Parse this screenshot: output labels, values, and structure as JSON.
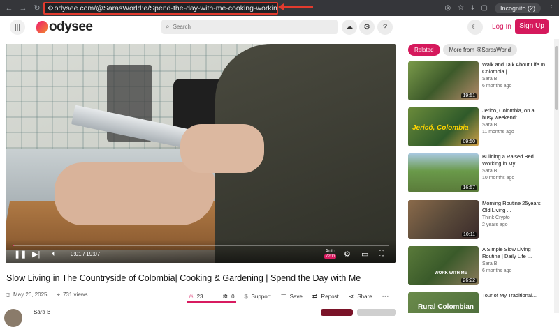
{
  "browser": {
    "url": "odysee.com/@SarasWorld:e/Spend-the-day-with-me-cooking-working-in-the-garden:f",
    "incognito_label": "Incognito (2)"
  },
  "header": {
    "logo_text": "odysee",
    "search_placeholder": "Search",
    "login_label": "Log In",
    "signup_label": "Sign Up"
  },
  "player": {
    "current_time": "0:01",
    "duration": "19:07",
    "separator": "/",
    "quality_mode": "Auto",
    "quality": "720p",
    "progress_fraction": 0.001
  },
  "video": {
    "title": "Slow Living in The Countryside of Colombia| Cooking & Gardening | Spend the Day with Me",
    "date": "May 26, 2025",
    "views": "731 views",
    "fire_count": "23",
    "slime_count": "0",
    "support_label": "Support",
    "save_label": "Save",
    "repost_label": "Repost",
    "share_label": "Share",
    "channel_name": "Sara B"
  },
  "sidebar": {
    "tabs": [
      {
        "label": "Related"
      },
      {
        "label": "More from @SarasWorld"
      }
    ],
    "items": [
      {
        "title": "Walk and Talk About Life In Colombia |...",
        "channel": "Sara B",
        "age": "6 months ago",
        "duration": "19:51"
      },
      {
        "title": "Jericó, Colombia, on a busy weekend:...",
        "channel": "Sara B",
        "age": "11 months ago",
        "duration": "09:50",
        "thumb_text": "Jericó, Colombia"
      },
      {
        "title": "Building a Raised Bed Working in My...",
        "channel": "Sara B",
        "age": "10 months ago",
        "duration": "16:57"
      },
      {
        "title": "Morning Routine 25years Old Living ...",
        "channel": "Think Crypto",
        "age": "2 years ago",
        "duration": "10:11"
      },
      {
        "title": "A Simple Slow Living Routine | Daily Life ...",
        "channel": "Sara B",
        "age": "6 months ago",
        "duration": "26:22",
        "thumb_text": "WORK WITH ME"
      },
      {
        "title": "Tour of My Traditional...",
        "channel": "",
        "age": "",
        "duration": "",
        "thumb_text": "Rural Colombian"
      }
    ]
  },
  "colors": {
    "brand": "#d5195c",
    "annotation": "#e23b2e"
  }
}
